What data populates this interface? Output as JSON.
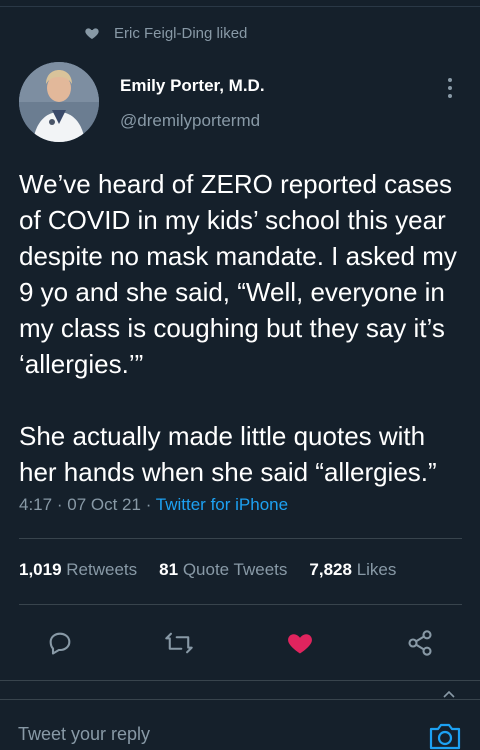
{
  "social_context": {
    "text": "Eric Feigl-Ding liked"
  },
  "author": {
    "name": "Emily Porter, M.D.",
    "handle": "@dremilyportermd"
  },
  "tweet": {
    "paragraphs": [
      "We’ve heard of ZERO reported cases of COVID in my kids’ school this year despite no mask mandate. I asked my 9 yo and she said, “Well, everyone in my class is coughing but they say it’s ‘allergies.’”",
      "She actually made little quotes with her hands when she said “allergies.”"
    ],
    "time": "4:17",
    "date": "07 Oct 21",
    "separator": "·",
    "source": "Twitter for iPhone"
  },
  "stats": {
    "retweets": {
      "count": "1,019",
      "label": "Retweets"
    },
    "quotes": {
      "count": "81",
      "label": "Quote Tweets"
    },
    "likes": {
      "count": "7,828",
      "label": "Likes"
    }
  },
  "actions": {
    "reply_icon": "reply-icon",
    "retweet_icon": "retweet-icon",
    "like_icon": "heart-filled-icon",
    "share_icon": "share-icon",
    "liked": true
  },
  "reply": {
    "placeholder": "Tweet your reply"
  },
  "colors": {
    "background": "#15202b",
    "secondary_text": "#8899a6",
    "link": "#1da1f2",
    "like": "#e0245e"
  }
}
